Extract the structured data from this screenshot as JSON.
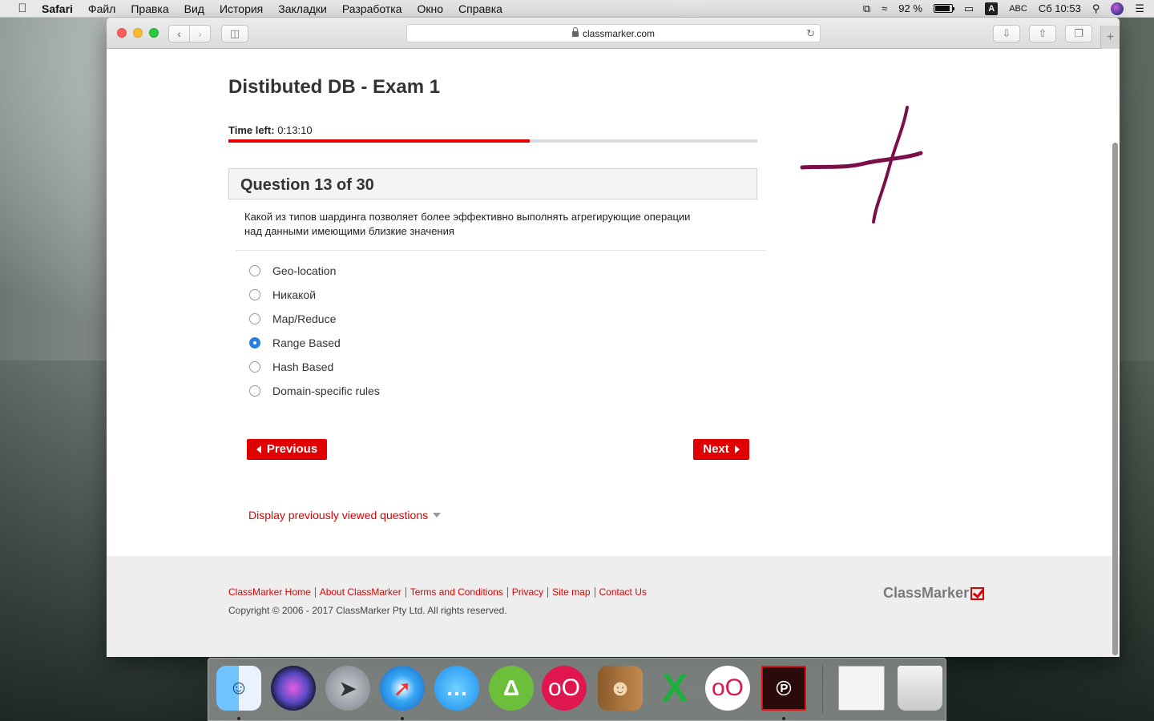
{
  "menubar": {
    "app": "Safari",
    "items": [
      "Файл",
      "Правка",
      "Вид",
      "История",
      "Закладки",
      "Разработка",
      "Окно",
      "Справка"
    ],
    "battery": "92 %",
    "input_source": "ABC",
    "input_letter": "A",
    "clock": "Сб 10:53"
  },
  "browser": {
    "url": "classmarker.com"
  },
  "exam": {
    "title": "Distibuted DB - Exam 1",
    "time_label": "Time left:",
    "time_value": "0:13:10",
    "progress_fraction": 0.57,
    "question_header": "Question 13 of 30",
    "question_text": "Какой из типов шардинга позволяет более эффективно выполнять агрегирующие операции над данными имеющими близкие значения",
    "answers": [
      {
        "label": "Geo-location",
        "selected": false
      },
      {
        "label": "Никакой",
        "selected": false
      },
      {
        "label": "Map/Reduce",
        "selected": false
      },
      {
        "label": "Range Based",
        "selected": true
      },
      {
        "label": "Hash Based",
        "selected": false
      },
      {
        "label": "Domain-specific rules",
        "selected": false
      }
    ],
    "prev_label": "Previous",
    "next_label": "Next",
    "display_previous": "Display previously viewed questions"
  },
  "footer": {
    "links": [
      "ClassMarker Home",
      "About ClassMarker",
      "Terms and Conditions",
      "Privacy",
      "Site map",
      "Contact Us"
    ],
    "copyright": "Copyright © 2006 - 2017 ClassMarker Pty Ltd. All rights reserved.",
    "logo_text": "ClassMarker"
  },
  "dock": {
    "apps": [
      "finder-icon",
      "siri-icon",
      "launchpad-icon",
      "safari-icon",
      "messages-icon",
      "android-studio-icon",
      "flickr-like-icon",
      "contacts-icon",
      "excel-icon",
      "flickr-like-icon-2",
      "acrobat-icon",
      "document-preview-icon",
      "trash-icon"
    ]
  },
  "colors": {
    "accent_red": "#e00000",
    "link_red": "#dd0000",
    "pen_stroke": "#7a0f4a"
  }
}
